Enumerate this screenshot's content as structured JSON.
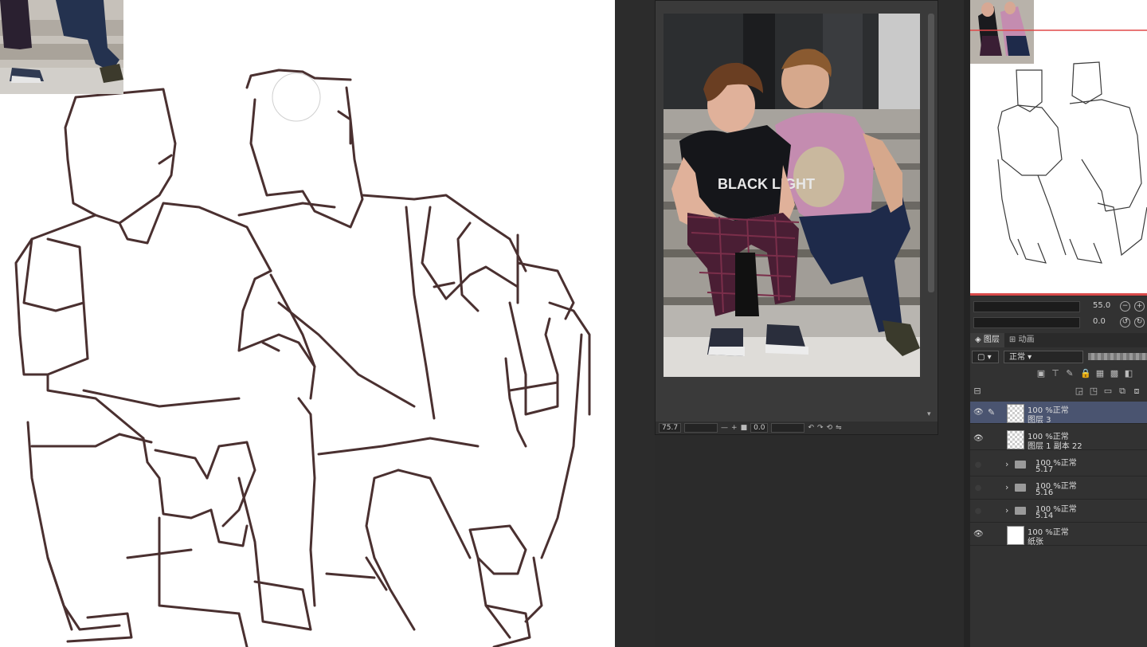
{
  "reference_window": {
    "toolbar": {
      "zoom": "75.7",
      "minus": "—",
      "plus": "+",
      "rotation": "0.0"
    }
  },
  "brush_size": {
    "size_value": "55.0",
    "angle_value": "0.0"
  },
  "layer_panel": {
    "tabs": [
      "图层",
      "动画"
    ],
    "blend_mode": "正常",
    "layers": [
      {
        "opacity": "100 %正常",
        "name": "图层 3",
        "selected": true,
        "visible": true,
        "type": "raster"
      },
      {
        "opacity": "100 %正常",
        "name": "图层 1 副本 22",
        "selected": false,
        "visible": true,
        "type": "raster"
      },
      {
        "opacity": "100 %正常",
        "name": "5.17",
        "selected": false,
        "visible": false,
        "type": "folder"
      },
      {
        "opacity": "100 %正常",
        "name": "5.16",
        "selected": false,
        "visible": false,
        "type": "folder"
      },
      {
        "opacity": "100 %正常",
        "name": "5.14",
        "selected": false,
        "visible": false,
        "type": "folder"
      },
      {
        "opacity": "100 %正常",
        "name": "纸张",
        "selected": false,
        "visible": true,
        "type": "paper"
      }
    ]
  },
  "photo_print": {
    "shirt_text": "BLACK LIGHT"
  }
}
